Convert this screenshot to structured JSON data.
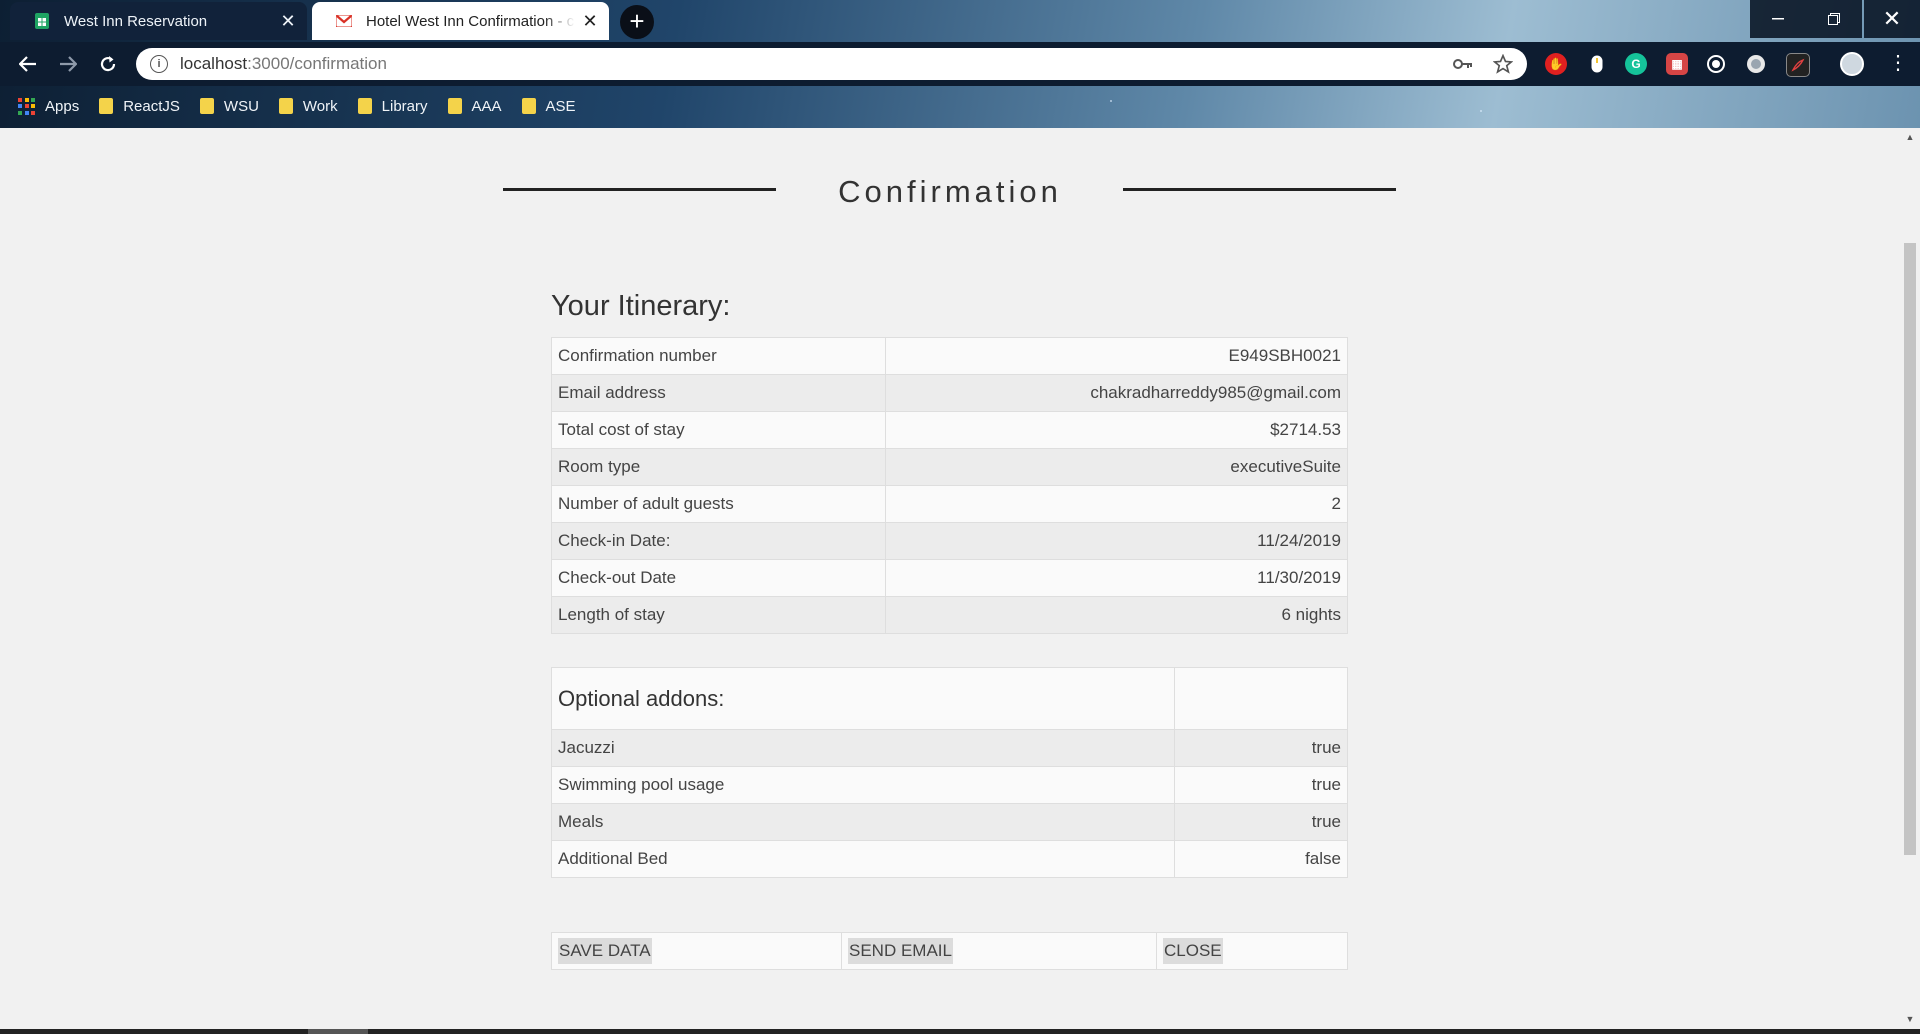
{
  "browser": {
    "tabs": [
      {
        "title": "West Inn Reservation",
        "active": false,
        "icon": "sheets-icon"
      },
      {
        "title": "Hotel West Inn Confirmation - ch",
        "active": true,
        "icon": "gmail-icon"
      }
    ],
    "url_host": "localhost",
    "url_rest": ":3000/confirmation",
    "bookmarks": [
      "Apps",
      "ReactJS",
      "WSU",
      "Work",
      "Library",
      "AAA",
      "ASE"
    ]
  },
  "page": {
    "heading": "Confirmation",
    "itinerary_title": "Your Itinerary:",
    "itinerary": [
      {
        "label": "Confirmation number",
        "value": "E949SBH0021"
      },
      {
        "label": "Email address",
        "value": "chakradharreddy985@gmail.com"
      },
      {
        "label": "Total cost of stay",
        "value": "$2714.53"
      },
      {
        "label": "Room type",
        "value": "executiveSuite"
      },
      {
        "label": "Number of adult guests",
        "value": "2"
      },
      {
        "label": "Check-in Date:",
        "value": "11/24/2019"
      },
      {
        "label": "Check-out Date",
        "value": "11/30/2019"
      },
      {
        "label": "Length of stay",
        "value": "6 nights"
      }
    ],
    "addons_title": "Optional addons:",
    "addons": [
      {
        "label": "Jacuzzi",
        "value": "true"
      },
      {
        "label": "Swimming pool usage",
        "value": "true"
      },
      {
        "label": "Meals",
        "value": "true"
      },
      {
        "label": "Additional Bed",
        "value": "false"
      }
    ],
    "buttons": {
      "save": "SAVE DATA",
      "email": "SEND EMAIL",
      "close": "CLOSE"
    }
  }
}
